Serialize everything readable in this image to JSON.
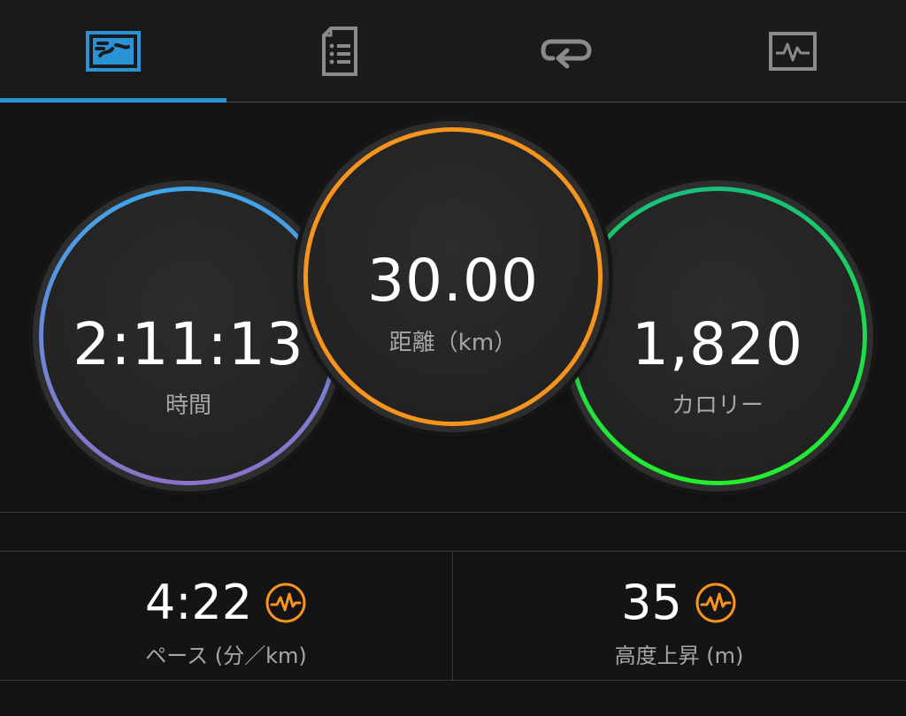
{
  "tabs": [
    {
      "icon": "activity-map-icon",
      "active": true
    },
    {
      "icon": "details-document-icon",
      "active": false
    },
    {
      "icon": "laps-repeat-icon",
      "active": false
    },
    {
      "icon": "chart-monitor-icon",
      "active": false
    }
  ],
  "colors": {
    "accent_blue": "#2a93d5",
    "distance_orange": "#f7941e",
    "time_gradient": [
      "#3ea5e9",
      "#8c72c8"
    ],
    "calorie_gradient": [
      "#19c07a",
      "#22ee2c"
    ],
    "hr_icon_orange": "#f7941e"
  },
  "rings": {
    "time": {
      "value": "2:11:13",
      "label": "時間"
    },
    "distance": {
      "value": "30.00",
      "label": "距離（km）"
    },
    "calories": {
      "value": "1,820",
      "label": "カロリー"
    }
  },
  "stats": {
    "pace": {
      "value": "4:22",
      "label": "ペース (分／km)",
      "icon": "heart-rate-icon"
    },
    "elevation": {
      "value": "35",
      "label": "高度上昇 (m)",
      "icon": "heart-rate-icon"
    }
  }
}
